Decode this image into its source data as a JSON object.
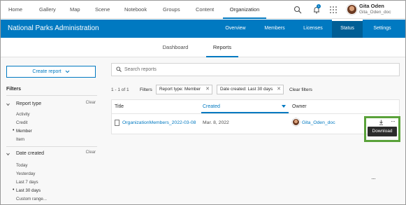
{
  "topnav": {
    "items": [
      {
        "label": "Home"
      },
      {
        "label": "Gallery"
      },
      {
        "label": "Map"
      },
      {
        "label": "Scene"
      },
      {
        "label": "Notebook"
      },
      {
        "label": "Groups"
      },
      {
        "label": "Content"
      },
      {
        "label": "Organization"
      }
    ],
    "active_item": "Organization",
    "notification_count": "1",
    "user": {
      "name": "Gita Oden",
      "username": "Gita_Oden_doc"
    }
  },
  "banner": {
    "org_title": "National Parks Administration",
    "tabs": [
      {
        "label": "Overview"
      },
      {
        "label": "Members"
      },
      {
        "label": "Licenses"
      },
      {
        "label": "Status"
      },
      {
        "label": "Settings"
      }
    ],
    "active_tab": "Status",
    "accent_color": "#0079c1"
  },
  "subtabs": {
    "items": [
      {
        "label": "Dashboard"
      },
      {
        "label": "Reports"
      }
    ],
    "active": "Reports"
  },
  "sidebar": {
    "create_button": "Create report",
    "filters_title": "Filters",
    "report_type": {
      "header": "Report type",
      "clear": "Clear",
      "options": [
        "Activity",
        "Credit",
        "Member",
        "Item"
      ],
      "selected": "Member"
    },
    "date_created": {
      "header": "Date created",
      "clear": "Clear",
      "options": [
        "Today",
        "Yesterday",
        "Last 7 days",
        "Last 30 days",
        "Custom range..."
      ],
      "selected": "Last 30 days"
    }
  },
  "main": {
    "search_placeholder": "Search reports",
    "count": "1 - 1 of 1",
    "filters_label": "Filters",
    "chips": [
      {
        "label": "Report type: Member"
      },
      {
        "label": "Date created: Last 30 days"
      }
    ],
    "clear_filters": "Clear filters",
    "table": {
      "columns": [
        "Title",
        "Created",
        "Owner"
      ],
      "sorted_column": "Created",
      "rows": [
        {
          "title": "OrganizationMembers_2022-03-08",
          "created": "Mar. 8, 2022",
          "owner": "Gita_Oden_doc"
        }
      ]
    },
    "tooltip": "Download",
    "more_glyph": "···"
  }
}
